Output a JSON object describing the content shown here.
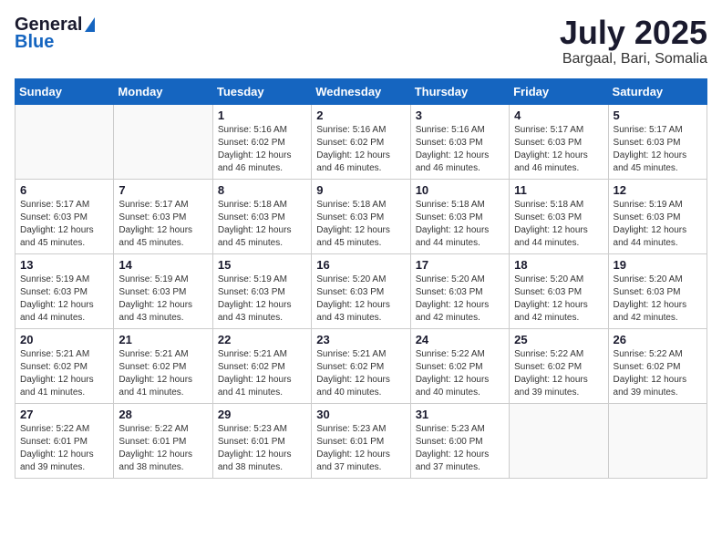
{
  "header": {
    "logo_general": "General",
    "logo_blue": "Blue",
    "month_year": "July 2025",
    "location": "Bargaal, Bari, Somalia"
  },
  "calendar": {
    "days_of_week": [
      "Sunday",
      "Monday",
      "Tuesday",
      "Wednesday",
      "Thursday",
      "Friday",
      "Saturday"
    ],
    "weeks": [
      [
        {
          "day": "",
          "info": ""
        },
        {
          "day": "",
          "info": ""
        },
        {
          "day": "1",
          "info": "Sunrise: 5:16 AM\nSunset: 6:02 PM\nDaylight: 12 hours\nand 46 minutes."
        },
        {
          "day": "2",
          "info": "Sunrise: 5:16 AM\nSunset: 6:02 PM\nDaylight: 12 hours\nand 46 minutes."
        },
        {
          "day": "3",
          "info": "Sunrise: 5:16 AM\nSunset: 6:03 PM\nDaylight: 12 hours\nand 46 minutes."
        },
        {
          "day": "4",
          "info": "Sunrise: 5:17 AM\nSunset: 6:03 PM\nDaylight: 12 hours\nand 46 minutes."
        },
        {
          "day": "5",
          "info": "Sunrise: 5:17 AM\nSunset: 6:03 PM\nDaylight: 12 hours\nand 45 minutes."
        }
      ],
      [
        {
          "day": "6",
          "info": "Sunrise: 5:17 AM\nSunset: 6:03 PM\nDaylight: 12 hours\nand 45 minutes."
        },
        {
          "day": "7",
          "info": "Sunrise: 5:17 AM\nSunset: 6:03 PM\nDaylight: 12 hours\nand 45 minutes."
        },
        {
          "day": "8",
          "info": "Sunrise: 5:18 AM\nSunset: 6:03 PM\nDaylight: 12 hours\nand 45 minutes."
        },
        {
          "day": "9",
          "info": "Sunrise: 5:18 AM\nSunset: 6:03 PM\nDaylight: 12 hours\nand 45 minutes."
        },
        {
          "day": "10",
          "info": "Sunrise: 5:18 AM\nSunset: 6:03 PM\nDaylight: 12 hours\nand 44 minutes."
        },
        {
          "day": "11",
          "info": "Sunrise: 5:18 AM\nSunset: 6:03 PM\nDaylight: 12 hours\nand 44 minutes."
        },
        {
          "day": "12",
          "info": "Sunrise: 5:19 AM\nSunset: 6:03 PM\nDaylight: 12 hours\nand 44 minutes."
        }
      ],
      [
        {
          "day": "13",
          "info": "Sunrise: 5:19 AM\nSunset: 6:03 PM\nDaylight: 12 hours\nand 44 minutes."
        },
        {
          "day": "14",
          "info": "Sunrise: 5:19 AM\nSunset: 6:03 PM\nDaylight: 12 hours\nand 43 minutes."
        },
        {
          "day": "15",
          "info": "Sunrise: 5:19 AM\nSunset: 6:03 PM\nDaylight: 12 hours\nand 43 minutes."
        },
        {
          "day": "16",
          "info": "Sunrise: 5:20 AM\nSunset: 6:03 PM\nDaylight: 12 hours\nand 43 minutes."
        },
        {
          "day": "17",
          "info": "Sunrise: 5:20 AM\nSunset: 6:03 PM\nDaylight: 12 hours\nand 42 minutes."
        },
        {
          "day": "18",
          "info": "Sunrise: 5:20 AM\nSunset: 6:03 PM\nDaylight: 12 hours\nand 42 minutes."
        },
        {
          "day": "19",
          "info": "Sunrise: 5:20 AM\nSunset: 6:03 PM\nDaylight: 12 hours\nand 42 minutes."
        }
      ],
      [
        {
          "day": "20",
          "info": "Sunrise: 5:21 AM\nSunset: 6:02 PM\nDaylight: 12 hours\nand 41 minutes."
        },
        {
          "day": "21",
          "info": "Sunrise: 5:21 AM\nSunset: 6:02 PM\nDaylight: 12 hours\nand 41 minutes."
        },
        {
          "day": "22",
          "info": "Sunrise: 5:21 AM\nSunset: 6:02 PM\nDaylight: 12 hours\nand 41 minutes."
        },
        {
          "day": "23",
          "info": "Sunrise: 5:21 AM\nSunset: 6:02 PM\nDaylight: 12 hours\nand 40 minutes."
        },
        {
          "day": "24",
          "info": "Sunrise: 5:22 AM\nSunset: 6:02 PM\nDaylight: 12 hours\nand 40 minutes."
        },
        {
          "day": "25",
          "info": "Sunrise: 5:22 AM\nSunset: 6:02 PM\nDaylight: 12 hours\nand 39 minutes."
        },
        {
          "day": "26",
          "info": "Sunrise: 5:22 AM\nSunset: 6:02 PM\nDaylight: 12 hours\nand 39 minutes."
        }
      ],
      [
        {
          "day": "27",
          "info": "Sunrise: 5:22 AM\nSunset: 6:01 PM\nDaylight: 12 hours\nand 39 minutes."
        },
        {
          "day": "28",
          "info": "Sunrise: 5:22 AM\nSunset: 6:01 PM\nDaylight: 12 hours\nand 38 minutes."
        },
        {
          "day": "29",
          "info": "Sunrise: 5:23 AM\nSunset: 6:01 PM\nDaylight: 12 hours\nand 38 minutes."
        },
        {
          "day": "30",
          "info": "Sunrise: 5:23 AM\nSunset: 6:01 PM\nDaylight: 12 hours\nand 37 minutes."
        },
        {
          "day": "31",
          "info": "Sunrise: 5:23 AM\nSunset: 6:00 PM\nDaylight: 12 hours\nand 37 minutes."
        },
        {
          "day": "",
          "info": ""
        },
        {
          "day": "",
          "info": ""
        }
      ]
    ]
  }
}
